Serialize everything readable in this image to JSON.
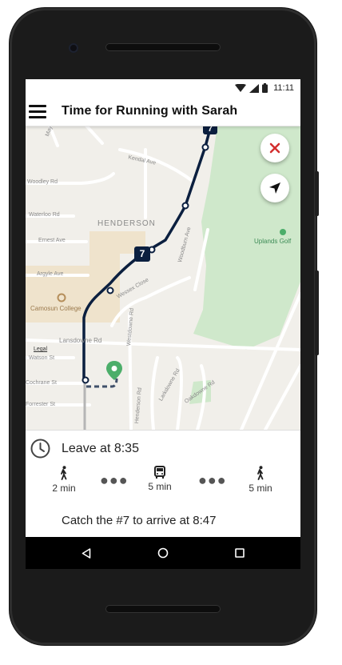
{
  "status_bar": {
    "time": "11:11"
  },
  "app_bar": {
    "title": "Time for Running with Sarah"
  },
  "map": {
    "neighborhood": "HENDERSON",
    "streets": {
      "kendal": "Kendal Ave",
      "woodley": "Woodley Rd",
      "waterloo": "Waterloo Rd",
      "ernest": "Ernest Ave",
      "argyle": "Argyle Ave",
      "wessex": "Wessex Close",
      "woodburn": "Woodburn Ave",
      "lansdowne": "Lansdowne Rd",
      "watson": "Watson St",
      "cochrane": "Cochrane St",
      "forrester": "Forrester St",
      "westdowne": "Westdowne Rd",
      "henderson_rd": "Henderson Rd",
      "larkdowne": "Larkdowne Rd",
      "oakdowne": "Oakdowne Rd",
      "mayfair": "Mayfair Dr"
    },
    "places": {
      "college": "Camosun College",
      "golf": "Uplands Golf"
    },
    "legal": "Legal",
    "bus_badge": "7",
    "bus_badge_top": "7",
    "route_color": "#0b1f3f",
    "park_color": "#cfe8cb",
    "destination_pin_color": "#4cae6a"
  },
  "buttons": {
    "close_icon_color": "#d32f2f"
  },
  "trip": {
    "leave_text": "Leave at 8:35",
    "steps": [
      {
        "icon": "walk-icon",
        "label": "2 min"
      },
      {
        "icon": "bus-icon",
        "label": "5 min"
      },
      {
        "icon": "walk-icon",
        "label": "5 min"
      }
    ],
    "catch_text": "Catch the #7 to arrive at 8:47"
  }
}
